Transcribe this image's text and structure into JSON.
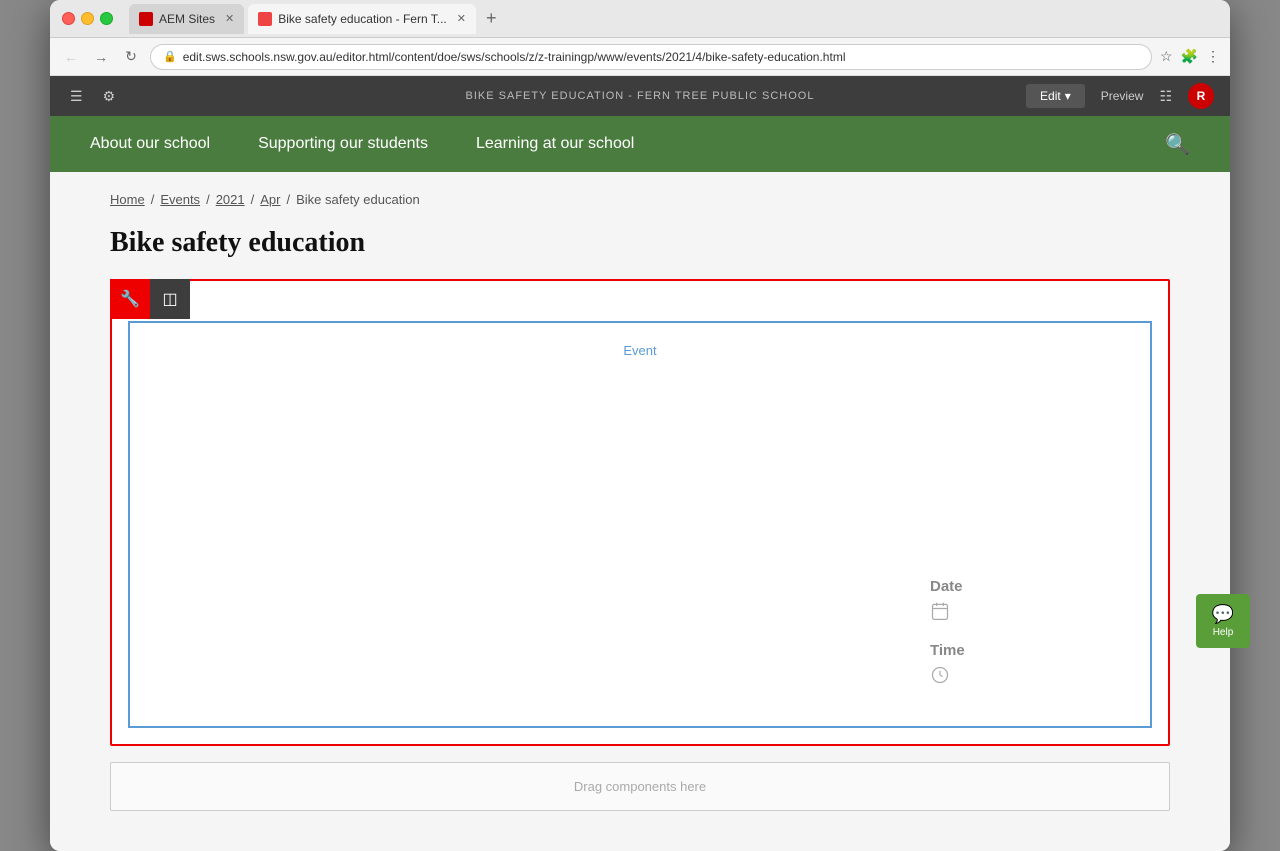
{
  "browser": {
    "tabs": [
      {
        "id": "aem",
        "label": "AEM Sites",
        "favicon_type": "aem",
        "active": false
      },
      {
        "id": "page",
        "label": "Bike safety education - Fern T...",
        "favicon_type": "page",
        "active": true
      }
    ],
    "url": "edit.sws.schools.nsw.gov.au/editor.html/content/doe/sws/schools/z/z-trainingp/www/events/2021/4/bike-safety-education.html"
  },
  "aem_topbar": {
    "center_text": "BIKE SAFETY EDUCATION - FERN TREE PUBLIC SCHOOL",
    "edit_label": "Edit",
    "preview_label": "Preview",
    "avatar_label": "R"
  },
  "nav": {
    "items": [
      {
        "id": "about",
        "label": "About our school"
      },
      {
        "id": "supporting",
        "label": "Supporting our students"
      },
      {
        "id": "learning",
        "label": "Learning at our school"
      }
    ]
  },
  "breadcrumb": {
    "items": [
      {
        "label": "Home",
        "link": true
      },
      {
        "label": "Events",
        "link": true
      },
      {
        "label": "2021",
        "link": true
      },
      {
        "label": "Apr",
        "link": true
      },
      {
        "label": "Bike safety education",
        "link": false
      }
    ]
  },
  "page": {
    "title": "Bike safety education"
  },
  "event_component": {
    "event_label": "Event",
    "date_label": "Date",
    "time_label": "Time"
  },
  "drag_zone": {
    "label": "Drag components here"
  },
  "help": {
    "label": "Help"
  }
}
